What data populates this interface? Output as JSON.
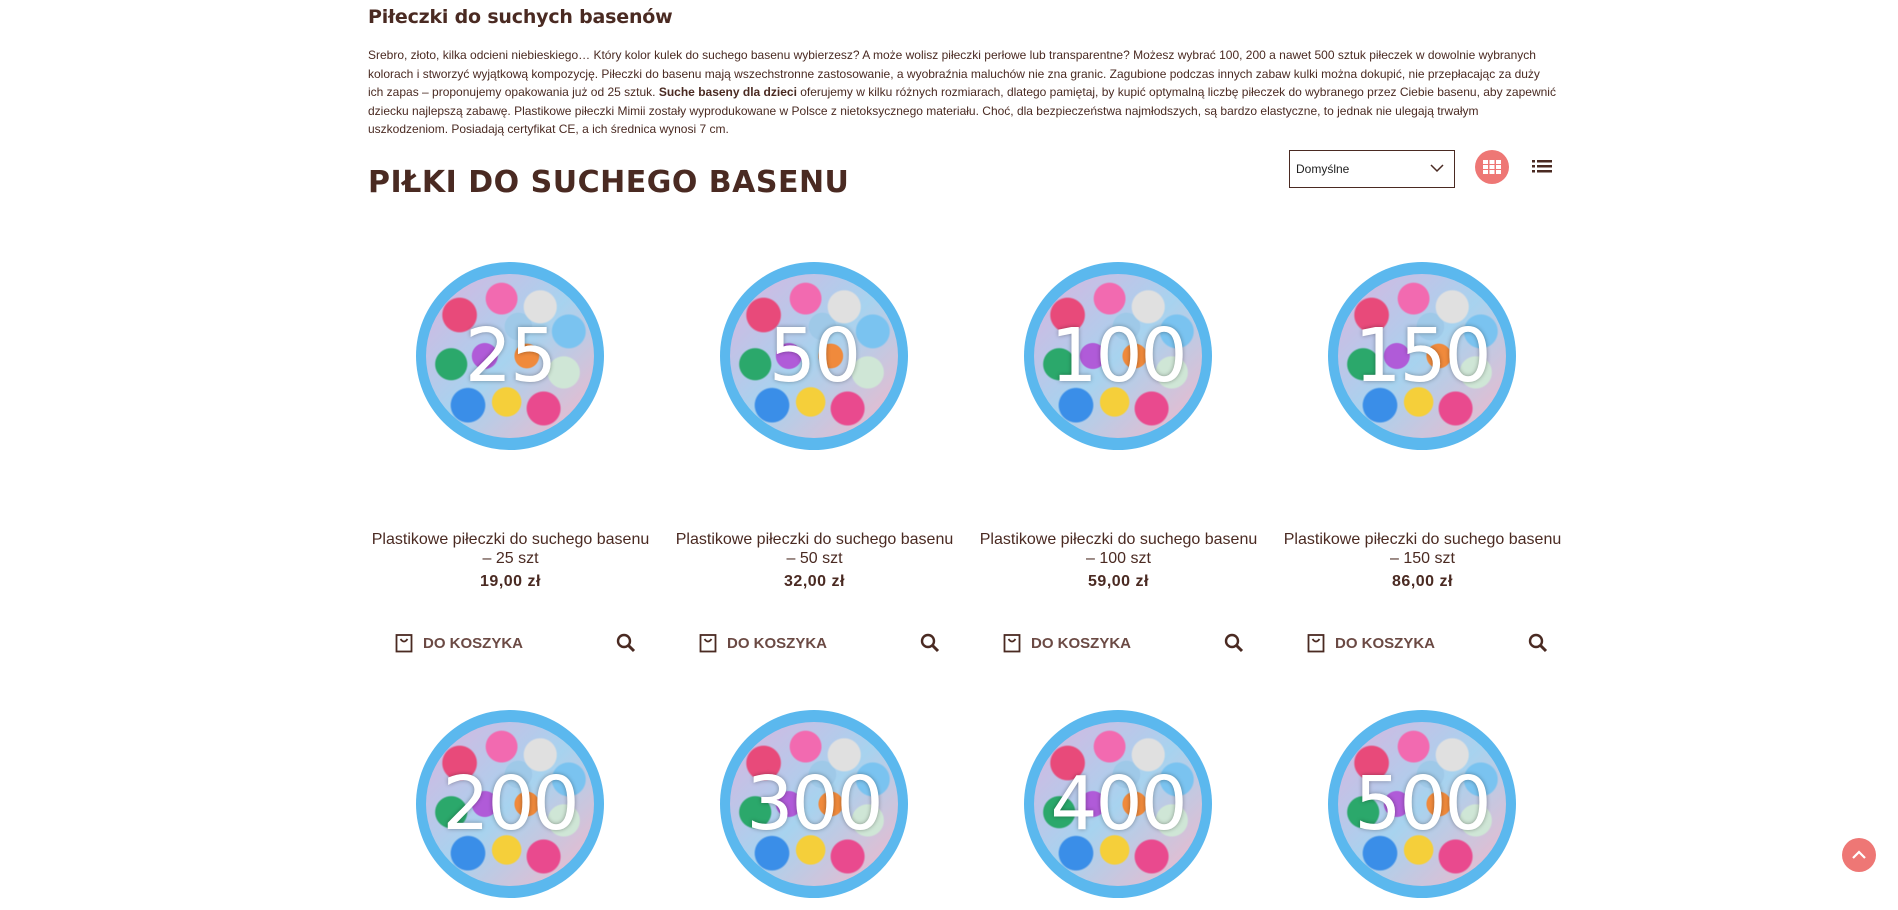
{
  "intro": {
    "title": "Piłeczki do suchych basenów",
    "text_part1": "Srebro, złoto, kilka odcieni niebieskiego… Który kolor kulek do suchego basenu wybierzesz? A może wolisz piłeczki perłowe lub transparentne? Możesz wybrać 100, 200 a nawet 500 sztuk piłeczek w dowolnie wybranych kolorach i stworzyć wyjątkową kompozycję. Piłeczki do basenu mają wszechstronne zastosowanie, a wyobraźnia maluchów nie zna granic. Zagubione podczas innych zabaw kulki można dokupić, nie przepłacając za duży ich zapas – proponujemy opakowania już od 25 sztuk. ",
    "text_bold": "Suche baseny dla dzieci",
    "text_part2": " oferujemy w kilku różnych rozmiarach, dlatego pamiętaj, by kupić optymalną liczbę piłeczek do wybranego przez Ciebie basenu, aby  zapewnić dziecku najlepszą zabawę. Plastikowe piłeczki Mimii zostały wyprodukowane w Polsce z nietoksycznego materiału. Choć, dla bezpieczeństwa najmłodszych, są bardzo elastyczne, to jednak nie ulegają trwałym uszkodzeniom. Posiadają certyfikat CE, a ich średnica wynosi 7 cm."
  },
  "category": {
    "title": "PIŁKI DO SUCHEGO BASENU"
  },
  "sort": {
    "selected": "Domyślne"
  },
  "colors": {
    "accent": "#ee7775",
    "text": "#4a2a22",
    "ball_ring": "#5bb8ee"
  },
  "products": [
    {
      "count": "25",
      "name": "Plastikowe piłeczki do suchego basenu – 25 szt",
      "price": "19,00 zł",
      "cart_label": "DO KOSZYKA"
    },
    {
      "count": "50",
      "name": "Plastikowe piłeczki do suchego basenu – 50 szt",
      "price": "32,00 zł",
      "cart_label": "DO KOSZYKA"
    },
    {
      "count": "100",
      "name": "Plastikowe piłeczki do suchego basenu – 100 szt",
      "price": "59,00 zł",
      "cart_label": "DO KOSZYKA"
    },
    {
      "count": "150",
      "name": "Plastikowe piłeczki do suchego basenu – 150 szt",
      "price": "86,00 zł",
      "cart_label": "DO KOSZYKA"
    },
    {
      "count": "200"
    },
    {
      "count": "300"
    },
    {
      "count": "400"
    },
    {
      "count": "500"
    }
  ]
}
